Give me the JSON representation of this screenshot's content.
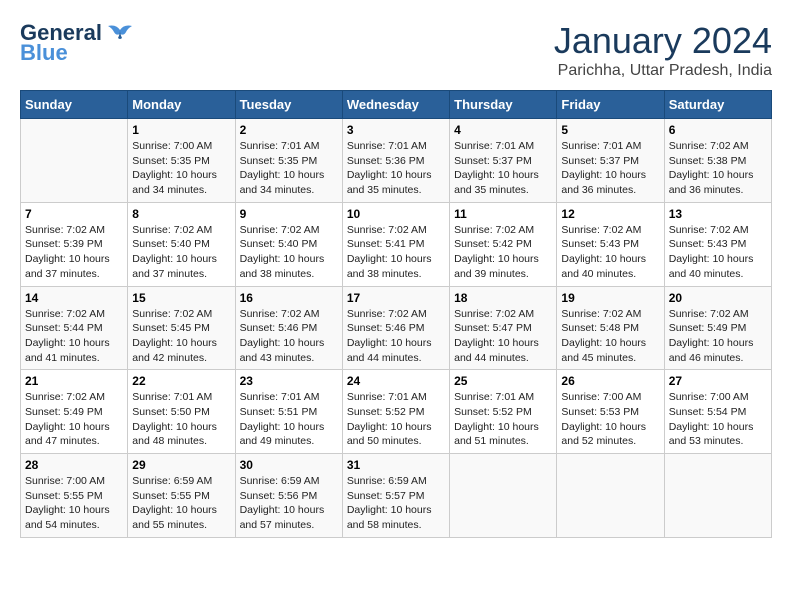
{
  "header": {
    "logo_general": "General",
    "logo_blue": "Blue",
    "month_year": "January 2024",
    "location": "Parichha, Uttar Pradesh, India"
  },
  "days_of_week": [
    "Sunday",
    "Monday",
    "Tuesday",
    "Wednesday",
    "Thursday",
    "Friday",
    "Saturday"
  ],
  "weeks": [
    [
      {
        "day": "",
        "content": ""
      },
      {
        "day": "1",
        "content": "Sunrise: 7:00 AM\nSunset: 5:35 PM\nDaylight: 10 hours\nand 34 minutes."
      },
      {
        "day": "2",
        "content": "Sunrise: 7:01 AM\nSunset: 5:35 PM\nDaylight: 10 hours\nand 34 minutes."
      },
      {
        "day": "3",
        "content": "Sunrise: 7:01 AM\nSunset: 5:36 PM\nDaylight: 10 hours\nand 35 minutes."
      },
      {
        "day": "4",
        "content": "Sunrise: 7:01 AM\nSunset: 5:37 PM\nDaylight: 10 hours\nand 35 minutes."
      },
      {
        "day": "5",
        "content": "Sunrise: 7:01 AM\nSunset: 5:37 PM\nDaylight: 10 hours\nand 36 minutes."
      },
      {
        "day": "6",
        "content": "Sunrise: 7:02 AM\nSunset: 5:38 PM\nDaylight: 10 hours\nand 36 minutes."
      }
    ],
    [
      {
        "day": "7",
        "content": "Sunrise: 7:02 AM\nSunset: 5:39 PM\nDaylight: 10 hours\nand 37 minutes."
      },
      {
        "day": "8",
        "content": "Sunrise: 7:02 AM\nSunset: 5:40 PM\nDaylight: 10 hours\nand 37 minutes."
      },
      {
        "day": "9",
        "content": "Sunrise: 7:02 AM\nSunset: 5:40 PM\nDaylight: 10 hours\nand 38 minutes."
      },
      {
        "day": "10",
        "content": "Sunrise: 7:02 AM\nSunset: 5:41 PM\nDaylight: 10 hours\nand 38 minutes."
      },
      {
        "day": "11",
        "content": "Sunrise: 7:02 AM\nSunset: 5:42 PM\nDaylight: 10 hours\nand 39 minutes."
      },
      {
        "day": "12",
        "content": "Sunrise: 7:02 AM\nSunset: 5:43 PM\nDaylight: 10 hours\nand 40 minutes."
      },
      {
        "day": "13",
        "content": "Sunrise: 7:02 AM\nSunset: 5:43 PM\nDaylight: 10 hours\nand 40 minutes."
      }
    ],
    [
      {
        "day": "14",
        "content": "Sunrise: 7:02 AM\nSunset: 5:44 PM\nDaylight: 10 hours\nand 41 minutes."
      },
      {
        "day": "15",
        "content": "Sunrise: 7:02 AM\nSunset: 5:45 PM\nDaylight: 10 hours\nand 42 minutes."
      },
      {
        "day": "16",
        "content": "Sunrise: 7:02 AM\nSunset: 5:46 PM\nDaylight: 10 hours\nand 43 minutes."
      },
      {
        "day": "17",
        "content": "Sunrise: 7:02 AM\nSunset: 5:46 PM\nDaylight: 10 hours\nand 44 minutes."
      },
      {
        "day": "18",
        "content": "Sunrise: 7:02 AM\nSunset: 5:47 PM\nDaylight: 10 hours\nand 44 minutes."
      },
      {
        "day": "19",
        "content": "Sunrise: 7:02 AM\nSunset: 5:48 PM\nDaylight: 10 hours\nand 45 minutes."
      },
      {
        "day": "20",
        "content": "Sunrise: 7:02 AM\nSunset: 5:49 PM\nDaylight: 10 hours\nand 46 minutes."
      }
    ],
    [
      {
        "day": "21",
        "content": "Sunrise: 7:02 AM\nSunset: 5:49 PM\nDaylight: 10 hours\nand 47 minutes."
      },
      {
        "day": "22",
        "content": "Sunrise: 7:01 AM\nSunset: 5:50 PM\nDaylight: 10 hours\nand 48 minutes."
      },
      {
        "day": "23",
        "content": "Sunrise: 7:01 AM\nSunset: 5:51 PM\nDaylight: 10 hours\nand 49 minutes."
      },
      {
        "day": "24",
        "content": "Sunrise: 7:01 AM\nSunset: 5:52 PM\nDaylight: 10 hours\nand 50 minutes."
      },
      {
        "day": "25",
        "content": "Sunrise: 7:01 AM\nSunset: 5:52 PM\nDaylight: 10 hours\nand 51 minutes."
      },
      {
        "day": "26",
        "content": "Sunrise: 7:00 AM\nSunset: 5:53 PM\nDaylight: 10 hours\nand 52 minutes."
      },
      {
        "day": "27",
        "content": "Sunrise: 7:00 AM\nSunset: 5:54 PM\nDaylight: 10 hours\nand 53 minutes."
      }
    ],
    [
      {
        "day": "28",
        "content": "Sunrise: 7:00 AM\nSunset: 5:55 PM\nDaylight: 10 hours\nand 54 minutes."
      },
      {
        "day": "29",
        "content": "Sunrise: 6:59 AM\nSunset: 5:55 PM\nDaylight: 10 hours\nand 55 minutes."
      },
      {
        "day": "30",
        "content": "Sunrise: 6:59 AM\nSunset: 5:56 PM\nDaylight: 10 hours\nand 57 minutes."
      },
      {
        "day": "31",
        "content": "Sunrise: 6:59 AM\nSunset: 5:57 PM\nDaylight: 10 hours\nand 58 minutes."
      },
      {
        "day": "",
        "content": ""
      },
      {
        "day": "",
        "content": ""
      },
      {
        "day": "",
        "content": ""
      }
    ]
  ]
}
